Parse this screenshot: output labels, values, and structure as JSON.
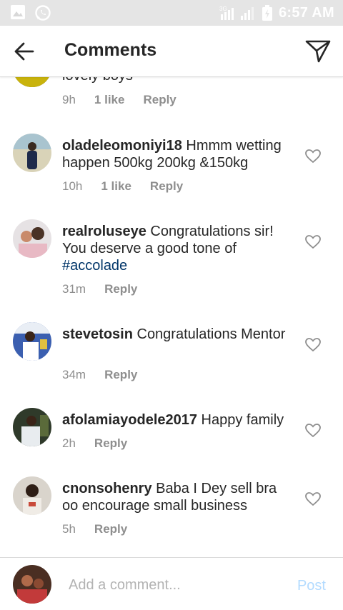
{
  "status_bar": {
    "time": "6:57 AM",
    "left_icons": [
      "image-icon",
      "whatsapp-icon"
    ],
    "right_icons": [
      "3g-icon",
      "signal-icon",
      "signal-icon",
      "battery-icon"
    ],
    "network_label": "3G"
  },
  "header": {
    "back_icon": "arrow-left-icon",
    "title": "Comments",
    "send_icon": "paper-plane-icon"
  },
  "comments": [
    {
      "username": "",
      "text": "lovely boys",
      "time": "9h",
      "likes": "1 like",
      "reply": "Reply",
      "partial": true
    },
    {
      "username": "oladeleomoniyi18",
      "text": " Hmmm wetting happen 500kg 200kg &150kg",
      "time": "10h",
      "likes": "1 like",
      "reply": "Reply"
    },
    {
      "username": "realroluseye",
      "text": " Congratulations sir! You deserve a good tone of ",
      "hashtag": "#accolade",
      "time": "31m",
      "reply": "Reply"
    },
    {
      "username": "stevetosin",
      "text": " Congratulations Mentor",
      "time": "34m",
      "reply": "Reply"
    },
    {
      "username": "afolamiayodele2017",
      "text": " Happy family",
      "time": "2h",
      "reply": "Reply"
    },
    {
      "username": "cnonsohenry",
      "text": " Baba I Dey sell bra oo encourage small business",
      "time": "5h",
      "reply": "Reply"
    }
  ],
  "composer": {
    "placeholder": "Add a comment...",
    "post_label": "Post"
  },
  "colors": {
    "hashtag": "#003569",
    "meta_text": "#8e8e8e",
    "post_disabled": "#b3dbff",
    "status_bar_bg": "#e5e5e5"
  }
}
